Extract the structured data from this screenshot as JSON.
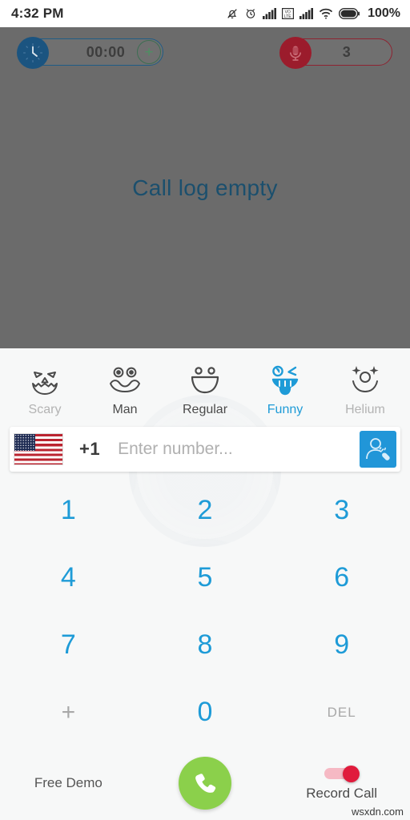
{
  "statusbar": {
    "time": "4:32 PM",
    "battery_percent": "100%",
    "icons": [
      "bell-muted-icon",
      "alarm-clock-icon",
      "signal-bars-icon",
      "volte-icon",
      "signal-bars-icon",
      "wifi-icon",
      "battery-icon"
    ]
  },
  "calllog": {
    "empty_message": "Call log empty",
    "timer_value": "00:00",
    "timer_icon": "clock-icon",
    "add_time_label": "+",
    "credits_value": "3",
    "credits_icon": "microphone-icon",
    "colors": {
      "background": "#6b6b6b",
      "empty_text": "#1b4f6d",
      "timer_border": "#1f5c86",
      "credits_border": "#8e2331"
    }
  },
  "effects": {
    "items": [
      {
        "label": "Scary",
        "icon": "scary-face-icon",
        "state": "dim"
      },
      {
        "label": "Man",
        "icon": "man-face-icon",
        "state": "normal"
      },
      {
        "label": "Regular",
        "icon": "regular-face-icon",
        "state": "normal"
      },
      {
        "label": "Funny",
        "icon": "funny-face-icon",
        "state": "active"
      },
      {
        "label": "Helium",
        "icon": "helium-face-icon",
        "state": "dim"
      }
    ],
    "active_color": "#1e9bd7"
  },
  "inputbar": {
    "flag": "us-flag-icon",
    "country_code": "+1",
    "number_value": "",
    "number_placeholder": "Enter number...",
    "contacts_icon": "contact-call-icon",
    "contacts_bg": "#2196d8"
  },
  "dialpad": {
    "rows": [
      [
        "1",
        "2",
        "3"
      ],
      [
        "4",
        "5",
        "6"
      ],
      [
        "7",
        "8",
        "9"
      ],
      [
        "+",
        "0",
        "DEL"
      ]
    ],
    "digit_color": "#1e9bd7"
  },
  "bottombar": {
    "demo_label": "Free Demo",
    "call_icon": "phone-handset-icon",
    "call_button_color": "#8bd04b",
    "record_label": "Record Call",
    "record_enabled": true,
    "record_toggle_color": "#e01b3c"
  },
  "watermark": "wsxdn.com"
}
